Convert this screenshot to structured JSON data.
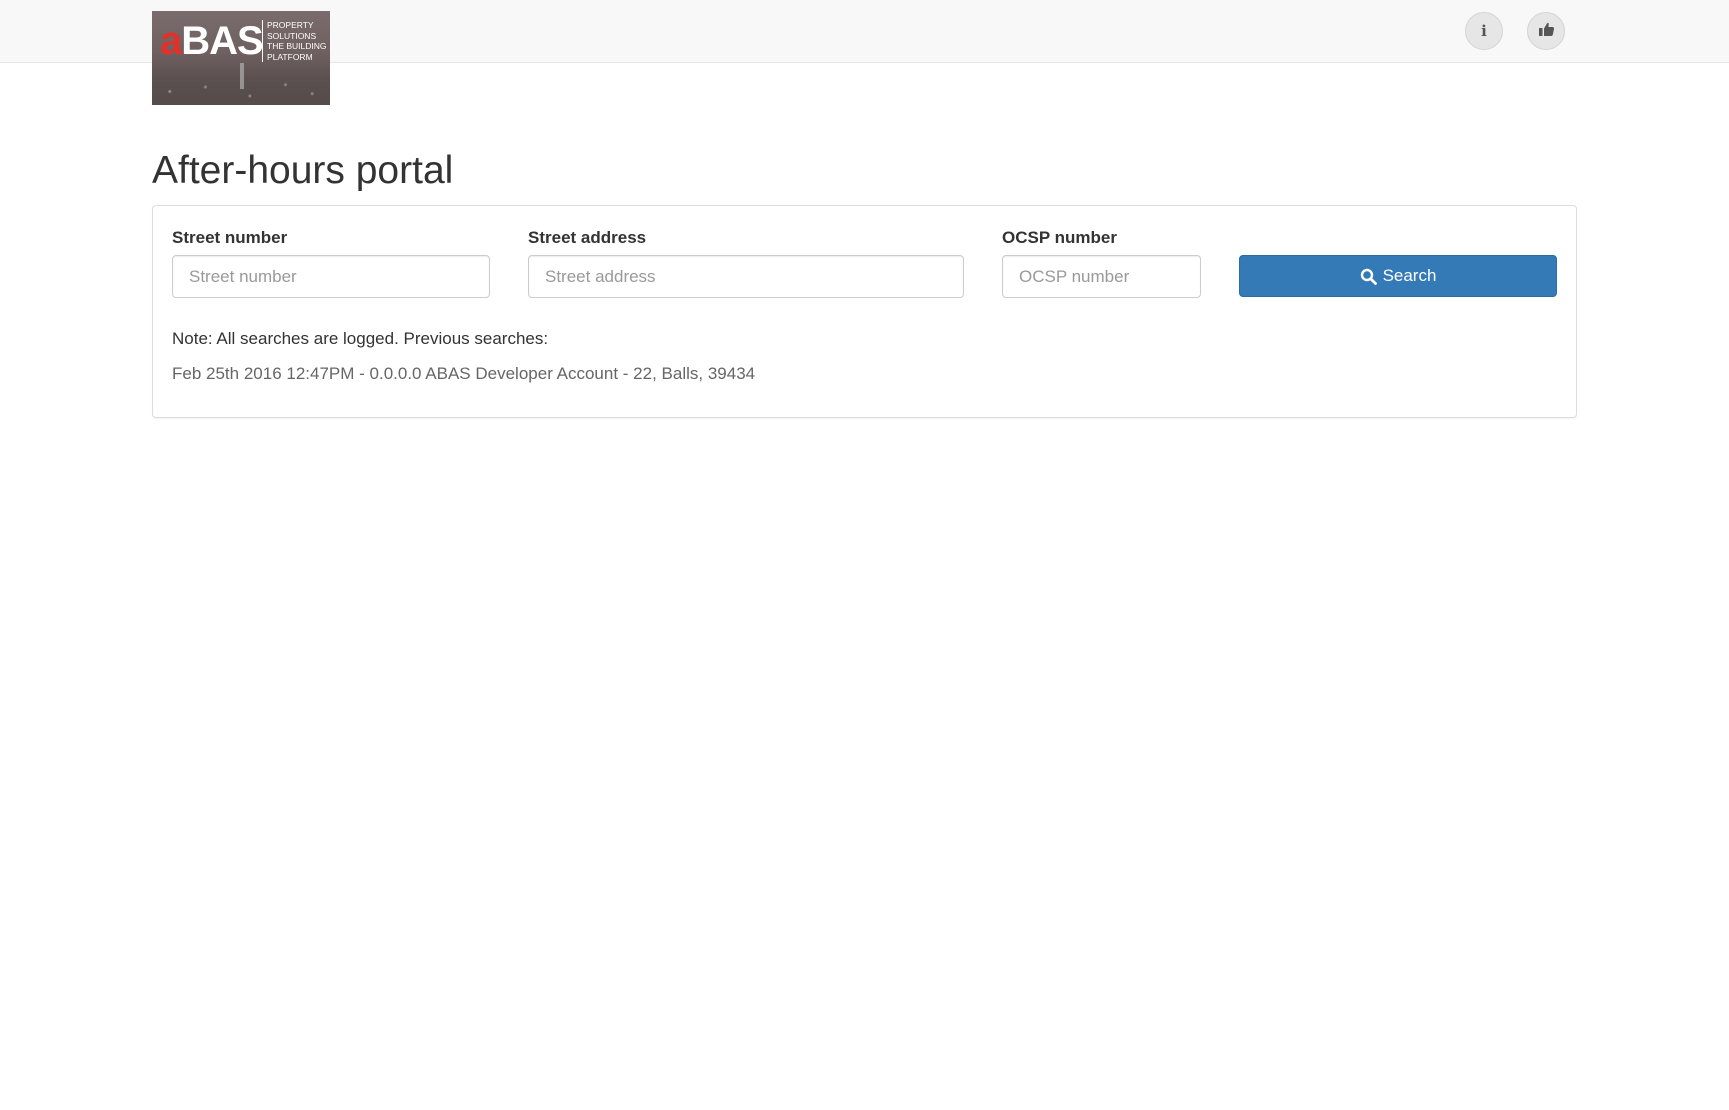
{
  "header": {
    "logo": {
      "wordmark_a": "a",
      "wordmark_rest": "BAS",
      "tagline": [
        "PROPERTY",
        "SOLUTIONS",
        "THE BUILDING",
        "PLATFORM"
      ]
    },
    "info_button": {
      "icon": "info-icon",
      "glyph": "i"
    },
    "like_button": {
      "icon": "thumbs-up-icon"
    }
  },
  "page": {
    "title": "After-hours portal"
  },
  "search_form": {
    "street_number": {
      "label": "Street number",
      "placeholder": "Street number",
      "value": ""
    },
    "street_address": {
      "label": "Street address",
      "placeholder": "Street address",
      "value": ""
    },
    "ocsp_number": {
      "label": "OCSP number",
      "placeholder": "OCSP number",
      "value": ""
    },
    "search_button": {
      "label": "Search",
      "icon": "search-icon",
      "color": "#337ab7"
    }
  },
  "log": {
    "note": "Note: All searches are logged. Previous searches:",
    "previous_searches": [
      "Feb 25th 2016 12:47PM - 0.0.0.0 ABAS Developer Account - 22, Balls, 39434"
    ]
  }
}
